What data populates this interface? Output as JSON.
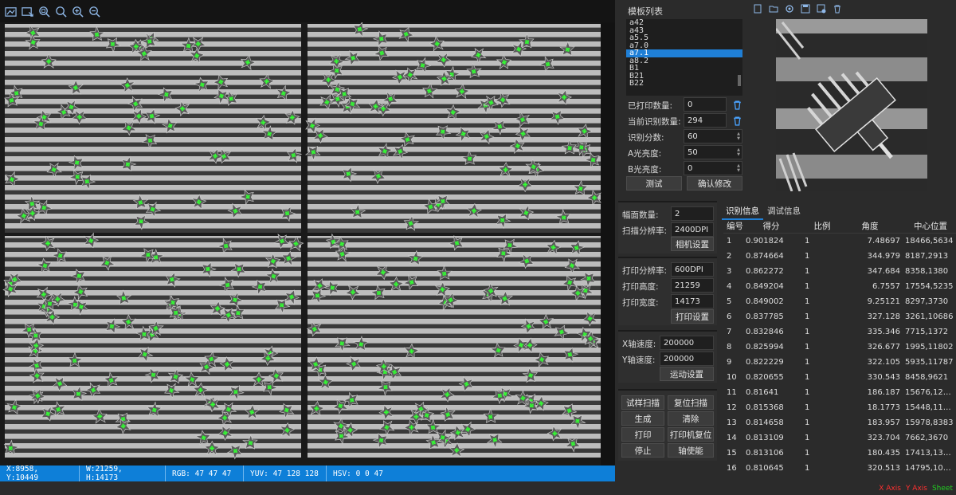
{
  "toolbar": {
    "icons": [
      "open-image-icon",
      "save-image-icon",
      "zoom-fit-icon",
      "zoom-reset-icon",
      "zoom-in-icon",
      "zoom-out-icon"
    ]
  },
  "statusbar": {
    "pos": "X:8958, Y:10449",
    "size": "W:21259, H:14173",
    "rgb": "RGB: 47 47 47",
    "yuv": "YUV: 47 128 128",
    "hsv": "HSV: 0 0 47"
  },
  "axis_legend": {
    "x": "X Axis",
    "y": "Y Axis",
    "z": "Sheet",
    "colors": {
      "x": "#ff3030",
      "y": "#ff3030",
      "z": "#22cc22"
    }
  },
  "template": {
    "title": "模板列表",
    "items": [
      "a42",
      "a43",
      "a5.5",
      "a7.0",
      "a7.1",
      "a8.2",
      "B1",
      "B21",
      "B22"
    ],
    "selected_index": 4,
    "file_icons": [
      "new-file-icon",
      "open-folder-icon",
      "gear-icon",
      "save-icon",
      "save-as-icon",
      "delete-icon"
    ]
  },
  "params": {
    "printed_count_label": "已打印数量:",
    "printed_count": "0",
    "recog_count_label": "当前识别数量:",
    "recog_count": "294",
    "score_label": "识别分数:",
    "score": "60",
    "a_light_label": "A光亮度:",
    "a_light": "50",
    "b_light_label": "B光亮度:",
    "b_light": "0",
    "test_btn": "测试",
    "confirm_btn": "确认修改"
  },
  "scan": {
    "face_count_label": "幅面数量:",
    "face_count": "2",
    "res_label": "扫描分辨率:",
    "res": "2400DPI",
    "camera_btn": "相机设置"
  },
  "print": {
    "res_label": "打印分辨率:",
    "res": "600DPI",
    "height_label": "打印高度:",
    "height": "21259",
    "width_label": "打印宽度:",
    "width": "14173",
    "btn": "打印设置"
  },
  "motion": {
    "x_label": "X轴速度:",
    "x": "200000",
    "y_label": "Y轴速度:",
    "y": "200000",
    "btn": "运动设置"
  },
  "actions": {
    "trial_scan": "试样扫描",
    "reset_scan": "复位扫描",
    "generate": "生成",
    "clear": "清除",
    "print": "打印",
    "printer_reset": "打印机复位",
    "stop": "停止",
    "axis_enable": "轴使能"
  },
  "tabs": {
    "info": "识别信息",
    "debug": "调试信息"
  },
  "table": {
    "headers": [
      "编号",
      "得分",
      "比例",
      "角度",
      "中心位置"
    ],
    "rows": [
      [
        "1",
        "0.901824",
        "1",
        "7.48697",
        "18466,5634"
      ],
      [
        "2",
        "0.874664",
        "1",
        "344.979",
        "8187,2913"
      ],
      [
        "3",
        "0.862272",
        "1",
        "347.684",
        "8358,1380"
      ],
      [
        "4",
        "0.849204",
        "1",
        "6.7557",
        "17554,5235"
      ],
      [
        "5",
        "0.849002",
        "1",
        "9.25121",
        "8297,3730"
      ],
      [
        "6",
        "0.837785",
        "1",
        "327.128",
        "3261,10686"
      ],
      [
        "7",
        "0.832846",
        "1",
        "335.346",
        "7715,1372"
      ],
      [
        "8",
        "0.825994",
        "1",
        "326.677",
        "1995,11802"
      ],
      [
        "9",
        "0.822229",
        "1",
        "322.105",
        "5935,11787"
      ],
      [
        "10",
        "0.820655",
        "1",
        "330.543",
        "8458,9621"
      ],
      [
        "11",
        "0.81641",
        "1",
        "186.187",
        "15676,12…"
      ],
      [
        "12",
        "0.815368",
        "1",
        "18.1773",
        "15448,11…"
      ],
      [
        "13",
        "0.814658",
        "1",
        "183.957",
        "15978,8383"
      ],
      [
        "14",
        "0.813109",
        "1",
        "323.704",
        "7662,3670"
      ],
      [
        "15",
        "0.813106",
        "1",
        "180.435",
        "17413,13…"
      ],
      [
        "16",
        "0.810645",
        "1",
        "320.513",
        "14795,10…"
      ]
    ]
  }
}
